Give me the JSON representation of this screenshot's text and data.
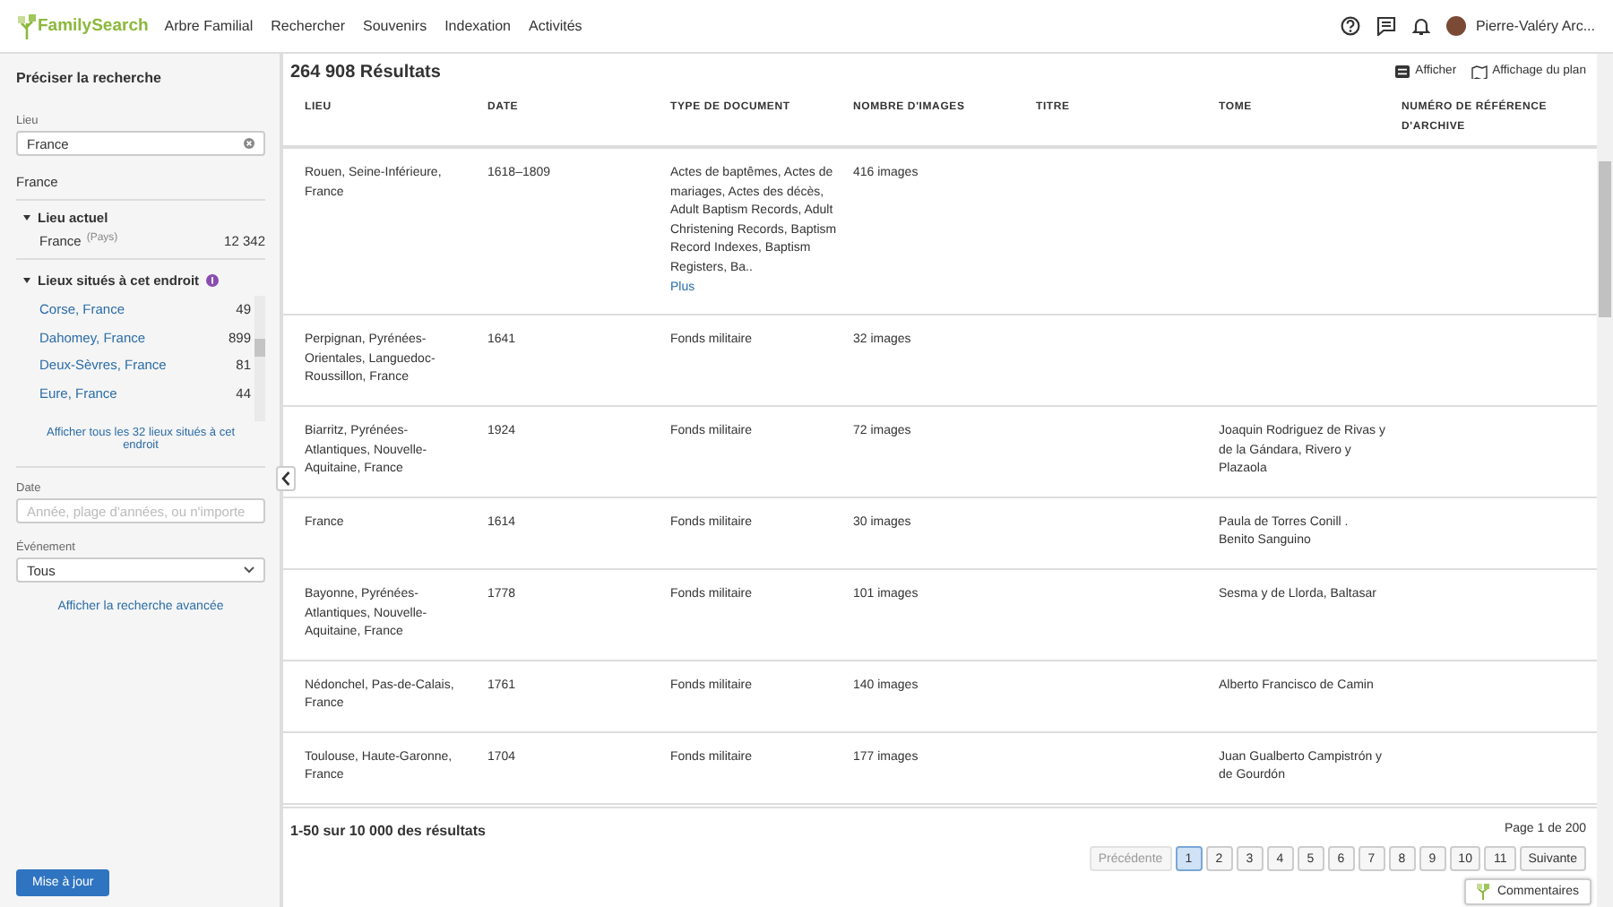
{
  "header": {
    "logo": "FamilySearch",
    "nav": [
      "Arbre Familial",
      "Rechercher",
      "Souvenirs",
      "Indexation",
      "Activités"
    ],
    "user": "Pierre-Valéry Arc..."
  },
  "sidebar": {
    "title": "Préciser la recherche",
    "place_field": {
      "label": "Lieu",
      "value": "France"
    },
    "place_heading": "France",
    "current_place": {
      "title": "Lieu actuel",
      "expanded": true,
      "name": "France",
      "type": "(Pays)",
      "count": "12 342"
    },
    "places_within": {
      "title": "Lieux situés à cet endroit",
      "expanded": true,
      "items": [
        {
          "name": "Corse, France",
          "count": "49"
        },
        {
          "name": "Dahomey, France",
          "count": "899"
        },
        {
          "name": "Deux-Sèvres, France",
          "count": "81"
        },
        {
          "name": "Eure, France",
          "count": "44"
        }
      ],
      "show_all": "Afficher tous les 32 lieux situés à cet endroit"
    },
    "date_field": {
      "label": "Date",
      "placeholder": "Année, plage d'années, ou n'importe"
    },
    "event_select": {
      "label": "Événement",
      "value": "Tous"
    },
    "advanced_link": "Afficher la recherche avancée",
    "update_button": "Mise à jour"
  },
  "results": {
    "count": "264 908 Résultats",
    "toolbar": [
      "Afficher",
      "Affichage du plan"
    ],
    "table": {
      "columns": [
        "LIEU",
        "DATE",
        "TYPE DE DOCUMENT",
        "NOMBRE D'IMAGES",
        "TITRE",
        "TOME",
        "NUMÉRO DE RÉFÉRENCE D'ARCHIVE"
      ],
      "rows": [
        {
          "lieu": "Rouen, Seine-Inférieure, France",
          "date": "1618–1809",
          "type_de_document": "Actes de baptêmes, Actes de mariages, Actes des décès, Adult Baptism Records, Adult Christening Records, Baptism Record Indexes, Baptism Registers, Ba..",
          "more_link": "Plus",
          "nombre_d_images": "416 images"
        },
        {
          "lieu": "Perpignan, Pyrénées-Orientales, Languedoc-Roussillon, France",
          "date": "1641",
          "type_de_document": "Fonds militaire",
          "nombre_d_images": "32 images"
        },
        {
          "lieu": "Biarritz, Pyrénées-Atlantiques, Nouvelle-Aquitaine, France",
          "date": "1924",
          "type_de_document": "Fonds militaire",
          "nombre_d_images": "72 images",
          "tome": "Joaquin Rodriguez de Rivas y de la Gándara, Rivero y Plazaola"
        },
        {
          "lieu": "France",
          "date": "1614",
          "type_de_document": "Fonds militaire",
          "nombre_d_images": "30 images",
          "tome": "Paula de Torres Conill . Benito Sanguino"
        },
        {
          "lieu": "Bayonne, Pyrénées-Atlantiques, Nouvelle-Aquitaine, France",
          "date": "1778",
          "type_de_document": "Fonds militaire",
          "nombre_d_images": "101 images",
          "tome": "Sesma y de Llorda, Baltasar"
        },
        {
          "lieu": "Nédonchel, Pas-de-Calais, France",
          "date": "1761",
          "type_de_document": "Fonds militaire",
          "nombre_d_images": "140 images",
          "tome": "Alberto Francisco de Camin"
        },
        {
          "lieu": "Toulouse, Haute-Garonne, France",
          "date": "1704",
          "type_de_document": "Fonds militaire",
          "nombre_d_images": "177 images",
          "tome": "Juan Gualberto Campistrón y de Gourdón"
        }
      ]
    }
  },
  "footer": {
    "summary": "1-50 sur 10 000 des résultats",
    "page_info": "Page 1 de 200",
    "previous": {
      "label": "Précédente",
      "disabled": true
    },
    "pages": [
      {
        "label": "1",
        "selected": true
      },
      {
        "label": "2",
        "selected": false
      },
      {
        "label": "3",
        "selected": false
      },
      {
        "label": "4",
        "selected": false
      },
      {
        "label": "5",
        "selected": false
      },
      {
        "label": "6",
        "selected": false
      },
      {
        "label": "7",
        "selected": false
      },
      {
        "label": "8",
        "selected": false
      },
      {
        "label": "9",
        "selected": false
      },
      {
        "label": "10",
        "selected": false
      },
      {
        "label": "11",
        "selected": false
      }
    ],
    "next": {
      "label": "Suivante",
      "disabled": false
    }
  },
  "feedback_button": "Commentaires"
}
